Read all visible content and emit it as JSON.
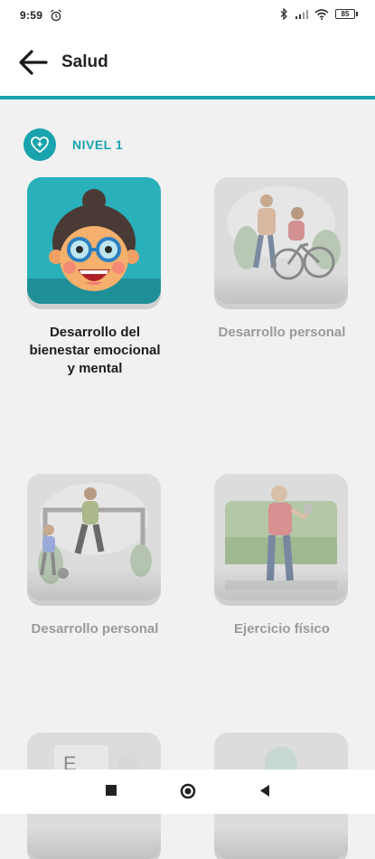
{
  "status_bar": {
    "time": "9:59",
    "battery": "85"
  },
  "header": {
    "title": "Salud"
  },
  "level": {
    "label": "NIVEL 1"
  },
  "cards": [
    {
      "label": "Desarrollo del bienestar emocional y mental",
      "state": "active"
    },
    {
      "label": "Desarrollo personal",
      "state": "locked"
    },
    {
      "label": "Desarrollo personal",
      "state": "locked"
    },
    {
      "label": "Ejercicio físico",
      "state": "locked"
    }
  ],
  "colors": {
    "accent": "#19a3ad",
    "card_active_bg": "#29b0ba",
    "locked_text": "#9a9a9a"
  }
}
